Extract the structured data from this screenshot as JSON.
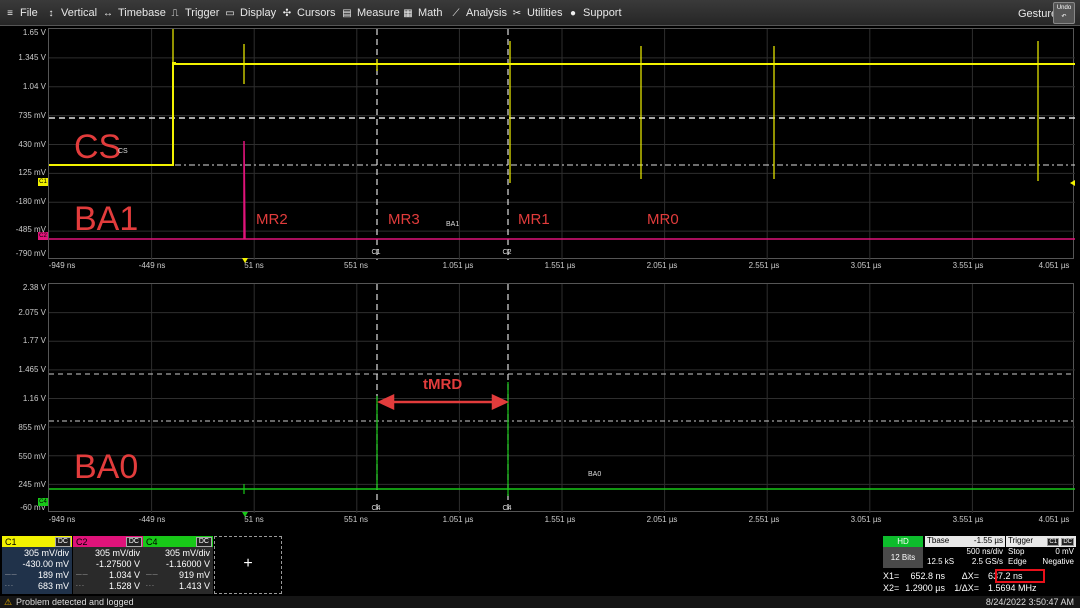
{
  "menu": [
    {
      "icon": "≡",
      "label": "File"
    },
    {
      "icon": "↕",
      "label": "Vertical"
    },
    {
      "icon": "↔",
      "label": "Timebase"
    },
    {
      "icon": "⎍",
      "label": "Trigger"
    },
    {
      "icon": "▭",
      "label": "Display"
    },
    {
      "icon": "✣",
      "label": "Cursors"
    },
    {
      "icon": "▤",
      "label": "Measure"
    },
    {
      "icon": "▦",
      "label": "Math"
    },
    {
      "icon": "⟋",
      "label": "Analysis"
    },
    {
      "icon": "✂",
      "label": "Utilities"
    },
    {
      "icon": "●",
      "label": "Support"
    }
  ],
  "gesture_label": "Gesture",
  "undo_label": "Undo",
  "pane1": {
    "y_ticks": [
      "1.65 V",
      "1.345 V",
      "1.04 V",
      "735 mV",
      "430 mV",
      "125 mV",
      "-180 mV",
      "-485 mV",
      "-790 mV"
    ],
    "x_ticks": [
      "-949 ns",
      "-449 ns",
      "51 ns",
      "551 ns",
      "1.051 µs",
      "1.551 µs",
      "2.051 µs",
      "2.551 µs",
      "3.051 µs",
      "3.551 µs",
      "4.051 µs"
    ],
    "cs_label": "CS",
    "cs_trace_tag": "CS",
    "ba1_label": "BA1",
    "ba1_trace_tag": "BA1",
    "mr_labels": [
      "MR2",
      "MR3",
      "MR1",
      "MR0"
    ],
    "cursor_tags": [
      "C1",
      "C2"
    ]
  },
  "pane2": {
    "y_ticks": [
      "2.38 V",
      "2.075 V",
      "1.77 V",
      "1.465 V",
      "1.16 V",
      "855 mV",
      "550 mV",
      "245 mV",
      "-60 mV"
    ],
    "x_ticks": [
      "-949 ns",
      "-449 ns",
      "51 ns",
      "551 ns",
      "1.051 µs",
      "1.551 µs",
      "2.051 µs",
      "2.551 µs",
      "3.051 µs",
      "3.551 µs",
      "4.051 µs"
    ],
    "ba0_label": "BA0",
    "ba0_trace_tag": "BA0",
    "tmrd_label": "tMRD",
    "cursor_tags": [
      "C4",
      "C4"
    ]
  },
  "channels": [
    {
      "name": "C1",
      "coupling": "DC",
      "color": "#f2f200",
      "vdiv": "305 mV/div",
      "offset": "-430.00 mV",
      "v1": "189 mV",
      "v2": "683 mV"
    },
    {
      "name": "C2",
      "coupling": "DC",
      "color": "#e0137a",
      "vdiv": "305 mV/div",
      "offset": "-1.27500 V",
      "v1": "1.034 V",
      "v2": "1.528 V"
    },
    {
      "name": "C4",
      "coupling": "DC",
      "color": "#18c818",
      "vdiv": "305 mV/div",
      "offset": "-1.16000 V",
      "v1": "919 mV",
      "v2": "1.413 V"
    }
  ],
  "add_channel_symbol": "+",
  "hd": {
    "top": "HD",
    "bits": "12 Bits"
  },
  "timebase": {
    "label": "Tbase",
    "delay": "-1.55 µs",
    "tdiv": "500 ns/div",
    "samples": "12.5 kS",
    "rate": "2.5 GS/s"
  },
  "trigger": {
    "label": "Trigger",
    "ch": "C1",
    "coupling": "DC",
    "mode": "Stop",
    "level": "0 mV",
    "type": "Edge",
    "slope": "Negative"
  },
  "cursors": {
    "x1_label": "X1=",
    "x1": "652.8 ns",
    "dx_label": "ΔX=",
    "dx": "637.2 ns",
    "x2_label": "X2=",
    "x2": "1.2900 µs",
    "inv_label": "1/ΔX=",
    "inv": "1.5694 MHz"
  },
  "status": {
    "message": "Problem detected and logged",
    "timestamp": "8/24/2022 3:50:47 AM"
  },
  "colors": {
    "c1": "#f2f200",
    "c2": "#e0137a",
    "c4": "#18c818",
    "annotation": "#e23c3c"
  }
}
